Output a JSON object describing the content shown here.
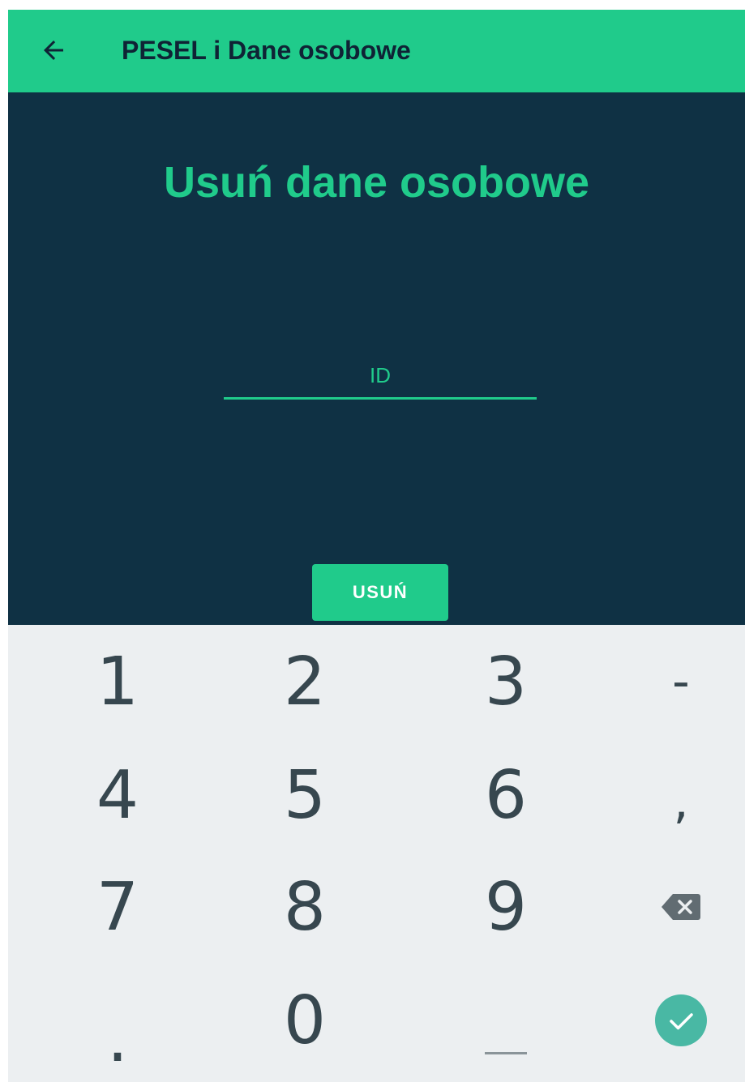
{
  "appbar": {
    "title": "PESEL i Dane osobowe",
    "back_icon": "arrow-left-icon"
  },
  "main": {
    "heading": "Usuń dane osobowe",
    "id_field": {
      "placeholder": "ID",
      "value": ""
    },
    "delete_button_label": "USUŃ"
  },
  "keyboard": {
    "row1": [
      "1",
      "2",
      "3",
      "-"
    ],
    "row2": [
      "4",
      "5",
      "6",
      ","
    ],
    "row3": [
      "7",
      "8",
      "9"
    ],
    "row4": [
      ".",
      "0"
    ],
    "backspace_icon": "backspace-icon",
    "space_icon": "space-bar-icon",
    "done_icon": "check-circle-icon"
  },
  "colors": {
    "accent": "#20cb8b",
    "content_bg": "#0f3144",
    "keyboard_bg": "#eceff1",
    "key_text": "#37474f",
    "done_button": "#49b8a4"
  }
}
